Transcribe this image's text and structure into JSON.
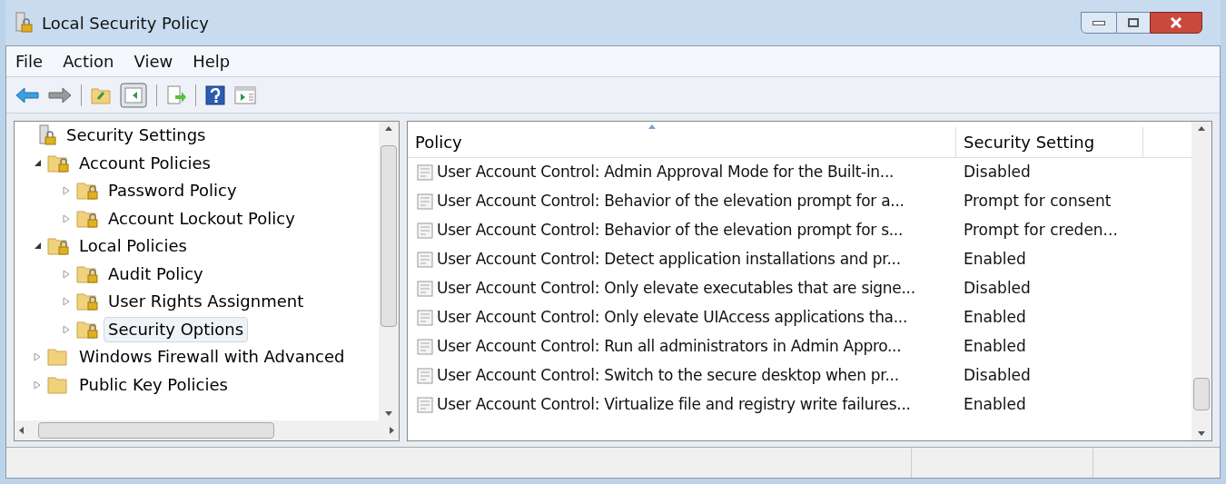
{
  "window": {
    "title": "Local Security Policy"
  },
  "menu": [
    "File",
    "Action",
    "View",
    "Help"
  ],
  "tree": [
    {
      "label": "Security Settings",
      "kind": "root",
      "selected": false,
      "children": [
        {
          "label": "Account Policies",
          "kind": "locked-folder",
          "selected": false,
          "expanded": true,
          "children": [
            {
              "label": "Password Policy",
              "kind": "locked-folder",
              "selected": false,
              "expanded": false
            },
            {
              "label": "Account Lockout Policy",
              "kind": "locked-folder",
              "selected": false,
              "expanded": false
            }
          ]
        },
        {
          "label": "Local Policies",
          "kind": "locked-folder",
          "selected": false,
          "expanded": true,
          "children": [
            {
              "label": "Audit Policy",
              "kind": "locked-folder",
              "selected": false,
              "expanded": false
            },
            {
              "label": "User Rights Assignment",
              "kind": "locked-folder",
              "selected": false,
              "expanded": false
            },
            {
              "label": "Security Options",
              "kind": "locked-folder",
              "selected": true,
              "expanded": false
            }
          ]
        },
        {
          "label": "Windows Firewall with Advanced",
          "kind": "folder",
          "selected": false,
          "expanded": false
        },
        {
          "label": "Public Key Policies",
          "kind": "folder",
          "selected": false,
          "expanded": false
        }
      ]
    }
  ],
  "table": {
    "columns": [
      "Policy",
      "Security Setting"
    ],
    "rows": [
      {
        "policy": "User Account Control: Admin Approval Mode for the Built-in...",
        "setting": "Disabled"
      },
      {
        "policy": "User Account Control: Behavior of the elevation prompt for a...",
        "setting": "Prompt for consent"
      },
      {
        "policy": "User Account Control: Behavior of the elevation prompt for s...",
        "setting": "Prompt for creden..."
      },
      {
        "policy": "User Account Control: Detect application installations and pr...",
        "setting": "Enabled"
      },
      {
        "policy": "User Account Control: Only elevate executables that are signe...",
        "setting": "Disabled"
      },
      {
        "policy": "User Account Control: Only elevate UIAccess applications tha...",
        "setting": "Enabled"
      },
      {
        "policy": "User Account Control: Run all administrators in Admin Appro...",
        "setting": "Enabled"
      },
      {
        "policy": "User Account Control: Switch to the secure desktop when pr...",
        "setting": "Disabled"
      },
      {
        "policy": "User Account Control: Virtualize file and registry write failures...",
        "setting": "Enabled"
      }
    ]
  }
}
